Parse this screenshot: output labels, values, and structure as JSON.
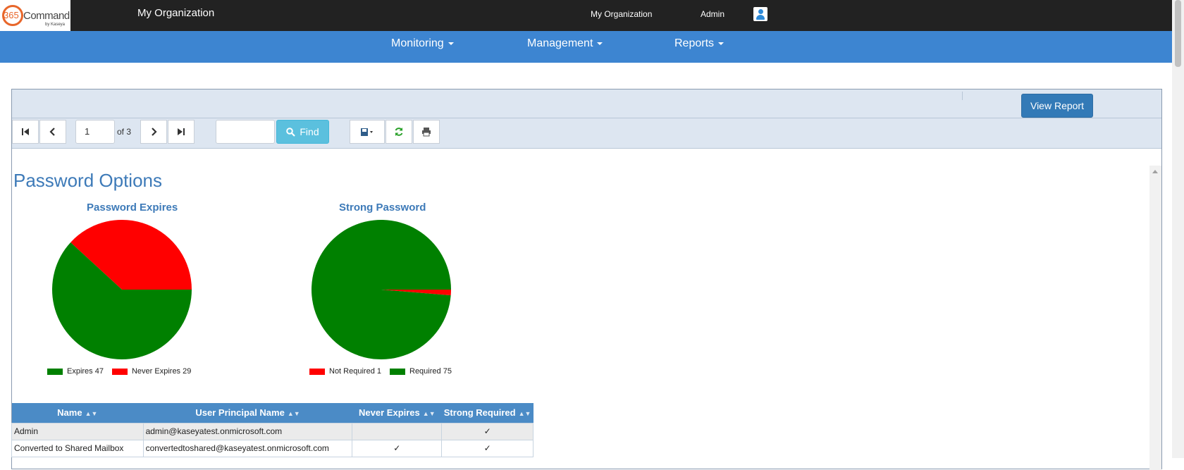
{
  "header": {
    "logo_num": "365",
    "logo_word": "Command",
    "logo_by": "by Kaseya",
    "org_title": "My Organization",
    "org_link": "My Organization",
    "user_link": "Admin"
  },
  "nav": {
    "items": [
      {
        "label": "Monitoring"
      },
      {
        "label": "Management"
      },
      {
        "label": "Reports"
      }
    ]
  },
  "report": {
    "view_report_label": "View Report",
    "page_current": "1",
    "page_total_label": "of 3",
    "find_label": "Find",
    "search_value": ""
  },
  "content": {
    "title": "Password Options"
  },
  "chart_data": [
    {
      "type": "pie",
      "title": "Password Expires",
      "categories": [
        "Expires",
        "Never Expires"
      ],
      "values": [
        47,
        29
      ],
      "colors": [
        "#008000",
        "#ff0000"
      ],
      "legend_labels": [
        "Expires 47",
        "Never Expires 29"
      ]
    },
    {
      "type": "pie",
      "title": "Strong Password",
      "categories": [
        "Not Required",
        "Required"
      ],
      "values": [
        1,
        75
      ],
      "colors": [
        "#ff0000",
        "#008000"
      ],
      "legend_labels": [
        "Not Required 1",
        "Required 75"
      ]
    }
  ],
  "table": {
    "headers": [
      "Name",
      "User Principal Name",
      "Never Expires",
      "Strong Required"
    ],
    "rows": [
      {
        "name": "Admin",
        "upn": "admin@kaseyatest.onmicrosoft.com",
        "never_expires": "",
        "strong_required": "✓"
      },
      {
        "name": "Converted to Shared Mailbox",
        "upn": "convertedtoshared@kaseyatest.onmicrosoft.com",
        "never_expires": "✓",
        "strong_required": "✓"
      }
    ]
  },
  "colors": {
    "topbar": "#222222",
    "navbar": "#3d85d1",
    "accent_title": "#3d7ab8",
    "table_header": "#4b8bc6"
  }
}
